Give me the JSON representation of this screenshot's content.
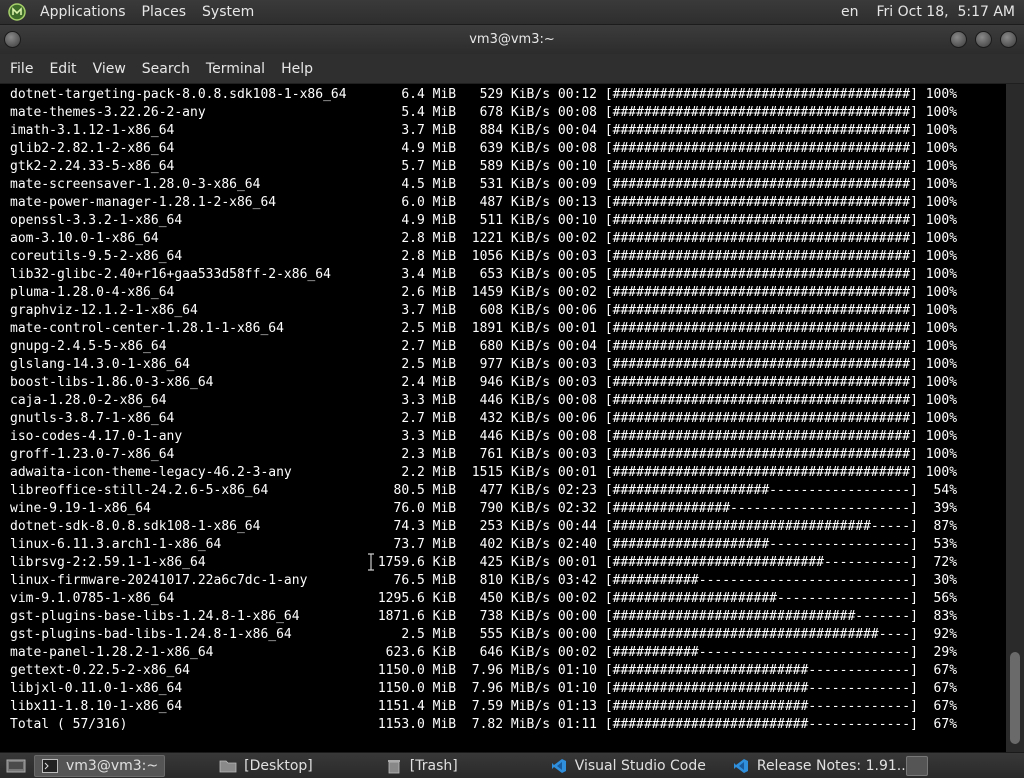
{
  "top_panel": {
    "menus": [
      "Applications",
      "Places",
      "System"
    ],
    "keyboard_layout": "en",
    "clock": "Fri Oct 18,  5:17 AM"
  },
  "window": {
    "title": "vm3@vm3:~"
  },
  "menubar": [
    "File",
    "Edit",
    "View",
    "Search",
    "Terminal",
    "Help"
  ],
  "terminal": {
    "lines": [
      "dotnet-targeting-pack-8.0.8.sdk108-1-x86_64       6.4 MiB   529 KiB/s 00:12 [######################################] 100%",
      "mate-themes-3.22.26-2-any                         5.4 MiB   678 KiB/s 00:08 [######################################] 100%",
      "imath-3.1.12-1-x86_64                             3.7 MiB   884 KiB/s 00:04 [######################################] 100%",
      "glib2-2.82.1-2-x86_64                             4.9 MiB   639 KiB/s 00:08 [######################################] 100%",
      "gtk2-2.24.33-5-x86_64                             5.7 MiB   589 KiB/s 00:10 [######################################] 100%",
      "mate-screensaver-1.28.0-3-x86_64                  4.5 MiB   531 KiB/s 00:09 [######################################] 100%",
      "mate-power-manager-1.28.1-2-x86_64                6.0 MiB   487 KiB/s 00:13 [######################################] 100%",
      "openssl-3.3.2-1-x86_64                            4.9 MiB   511 KiB/s 00:10 [######################################] 100%",
      "aom-3.10.0-1-x86_64                               2.8 MiB  1221 KiB/s 00:02 [######################################] 100%",
      "coreutils-9.5-2-x86_64                            2.8 MiB  1056 KiB/s 00:03 [######################################] 100%",
      "lib32-glibc-2.40+r16+gaa533d58ff-2-x86_64         3.4 MiB   653 KiB/s 00:05 [######################################] 100%",
      "pluma-1.28.0-4-x86_64                             2.6 MiB  1459 KiB/s 00:02 [######################################] 100%",
      "graphviz-12.1.2-1-x86_64                          3.7 MiB   608 KiB/s 00:06 [######################################] 100%",
      "mate-control-center-1.28.1-1-x86_64               2.5 MiB  1891 KiB/s 00:01 [######################################] 100%",
      "gnupg-2.4.5-5-x86_64                              2.7 MiB   680 KiB/s 00:04 [######################################] 100%",
      "glslang-14.3.0-1-x86_64                           2.5 MiB   977 KiB/s 00:03 [######################################] 100%",
      "boost-libs-1.86.0-3-x86_64                        2.4 MiB   946 KiB/s 00:03 [######################################] 100%",
      "caja-1.28.0-2-x86_64                              3.3 MiB   446 KiB/s 00:08 [######################################] 100%",
      "gnutls-3.8.7-1-x86_64                             2.7 MiB   432 KiB/s 00:06 [######################################] 100%",
      "iso-codes-4.17.0-1-any                            3.3 MiB   446 KiB/s 00:08 [######################################] 100%",
      "groff-1.23.0-7-x86_64                             2.3 MiB   761 KiB/s 00:03 [######################################] 100%",
      "adwaita-icon-theme-legacy-46.2-3-any              2.2 MiB  1515 KiB/s 00:01 [######################################] 100%",
      "libreoffice-still-24.2.6-5-x86_64                80.5 MiB   477 KiB/s 02:23 [####################------------------]  54%",
      "wine-9.19-1-x86_64                               76.0 MiB   790 KiB/s 02:32 [###############-----------------------]  39%",
      "dotnet-sdk-8.0.8.sdk108-1-x86_64                 74.3 MiB   253 KiB/s 00:44 [#################################-----]  87%",
      "linux-6.11.3.arch1-1-x86_64                      73.7 MiB   402 KiB/s 02:40 [####################------------------]  53%",
      "librsvg-2:2.59.1-1-x86_64                      1759.6 KiB   425 KiB/s 00:01 [###########################-----------]  72%",
      "linux-firmware-20241017.22a6c7dc-1-any           76.5 MiB   810 KiB/s 03:42 [###########---------------------------]  30%",
      "vim-9.1.0785-1-x86_64                          1295.6 KiB   450 KiB/s 00:02 [#####################-----------------]  56%",
      "gst-plugins-base-libs-1.24.8-1-x86_64          1871.6 KiB   738 KiB/s 00:00 [###############################-------]  83%",
      "gst-plugins-bad-libs-1.24.8-1-x86_64              2.5 MiB   555 KiB/s 00:00 [##################################----]  92%",
      "mate-panel-1.28.2-1-x86_64                      623.6 KiB   646 KiB/s 00:02 [###########---------------------------]  29%",
      "gettext-0.22.5-2-x86_64                        1150.0 MiB  7.96 MiB/s 01:10 [#########################-------------]  67%",
      "libjxl-0.11.0-1-x86_64                         1150.0 MiB  7.96 MiB/s 01:10 [#########################-------------]  67%",
      "libx11-1.8.10-1-x86_64                         1151.4 MiB  7.59 MiB/s 01:13 [#########################-------------]  67%",
      "Total ( 57/316)                                1153.0 MiB  7.82 MiB/s 01:11 [#########################-------------]  67%"
    ]
  },
  "taskbar": {
    "tasks": [
      {
        "label": "vm3@vm3:~",
        "icon": "terminal-icon",
        "active": true
      },
      {
        "label": "[Desktop]",
        "icon": "folder-icon",
        "active": false
      },
      {
        "label": "[Trash]",
        "icon": "trash-icon",
        "active": false
      },
      {
        "label": "Visual Studio Code",
        "icon": "vscode-icon",
        "active": false
      },
      {
        "label": "Release Notes: 1.91....",
        "icon": "vscode-icon",
        "active": false
      }
    ]
  },
  "colors": {
    "terminal_bg": "#000000",
    "terminal_fg": "#ffffff",
    "panel_bg": "#2e2e2e",
    "vscode_blue": "#2f8fdd"
  }
}
